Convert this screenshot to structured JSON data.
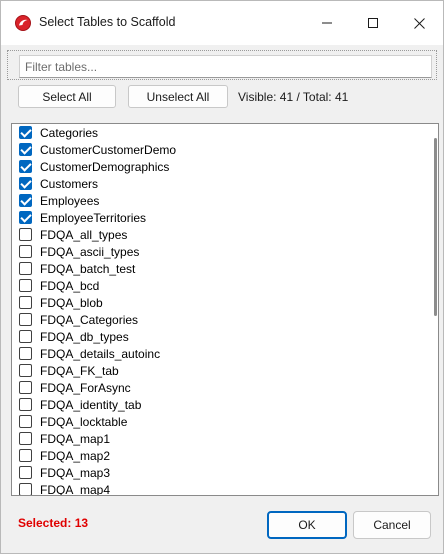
{
  "window": {
    "title": "Select Tables to Scaffold"
  },
  "filter": {
    "placeholder": "Filter tables...",
    "value": ""
  },
  "toolbar": {
    "select_all_label": "Select All",
    "unselect_all_label": "Unselect All",
    "visible_total": "Visible: 41 / Total: 41"
  },
  "tables": [
    {
      "name": "Categories",
      "checked": true
    },
    {
      "name": "CustomerCustomerDemo",
      "checked": true
    },
    {
      "name": "CustomerDemographics",
      "checked": true
    },
    {
      "name": "Customers",
      "checked": true
    },
    {
      "name": "Employees",
      "checked": true
    },
    {
      "name": "EmployeeTerritories",
      "checked": true
    },
    {
      "name": "FDQA_all_types",
      "checked": false
    },
    {
      "name": "FDQA_ascii_types",
      "checked": false
    },
    {
      "name": "FDQA_batch_test",
      "checked": false
    },
    {
      "name": "FDQA_bcd",
      "checked": false
    },
    {
      "name": "FDQA_blob",
      "checked": false
    },
    {
      "name": "FDQA_Categories",
      "checked": false
    },
    {
      "name": "FDQA_db_types",
      "checked": false
    },
    {
      "name": "FDQA_details_autoinc",
      "checked": false
    },
    {
      "name": "FDQA_FK_tab",
      "checked": false
    },
    {
      "name": "FDQA_ForAsync",
      "checked": false
    },
    {
      "name": "FDQA_identity_tab",
      "checked": false
    },
    {
      "name": "FDQA_locktable",
      "checked": false
    },
    {
      "name": "FDQA_map1",
      "checked": false
    },
    {
      "name": "FDQA_map2",
      "checked": false
    },
    {
      "name": "FDQA_map3",
      "checked": false
    },
    {
      "name": "FDQA_map4",
      "checked": false
    }
  ],
  "footer": {
    "selected_text": "Selected: 13",
    "ok_label": "OK",
    "cancel_label": "Cancel"
  },
  "colors": {
    "accent": "#0067c0",
    "selected_text": "#e00000",
    "app_icon": "#d9232a"
  },
  "icons": {
    "app": "app-logo-icon",
    "minimize": "minimize-icon",
    "maximize": "maximize-icon",
    "close": "close-icon",
    "checkbox": "checkbox-icon"
  }
}
